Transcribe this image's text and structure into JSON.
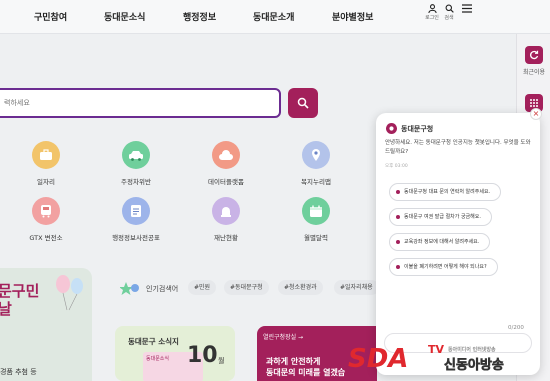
{
  "nav": {
    "items": [
      "구민참여",
      "동대문소식",
      "행정정보",
      "동대문소개",
      "분야별정보"
    ],
    "login_label": "로그인",
    "search_label": "검색"
  },
  "search": {
    "placeholder": "력하세요"
  },
  "right_rail": {
    "recent_label": "최근이용"
  },
  "quick_links": [
    {
      "label": "일자리",
      "color": "#f2c46a",
      "icon": "briefcase-icon"
    },
    {
      "label": "주정차위반",
      "color": "#6fcf9c",
      "icon": "car-icon"
    },
    {
      "label": "데이터플랫폼",
      "color": "#f29a86",
      "icon": "cloud-icon"
    },
    {
      "label": "복지누리맵",
      "color": "#b3c3ea",
      "icon": "map-icon"
    },
    {
      "label": "GTX 변전소",
      "color": "#f2a1a1",
      "icon": "bus-icon"
    },
    {
      "label": "행정정보사전공표",
      "color": "#9db4ea",
      "icon": "document-icon"
    },
    {
      "label": "재난현황",
      "color": "#c9b3e6",
      "icon": "siren-icon"
    },
    {
      "label": "월별달력",
      "color": "#6fcf9c",
      "icon": "calendar-icon"
    }
  ],
  "keywords": {
    "label": "인기검색어",
    "items": [
      "#민원",
      "#동대문구청",
      "#청소환경과",
      "#일자리채용"
    ]
  },
  "banners": {
    "left_big": "문구민\n날",
    "left_small": "경품 추첨 등",
    "news_title": "동대문구 소식지",
    "news_mini": "동대문소식",
    "news_num": "10",
    "news_month": "월",
    "open_title": "열린구청장실 →",
    "open_body": "과하게 안전하게\n동대문의 미래를 열겠습"
  },
  "chatbot": {
    "title": "동대문구청",
    "greeting": "안녕하세요. 저는 동대문구청 인공지능 챗봇입니다. 무엇을 도와드릴까요?",
    "time": "오후 03:00",
    "chips": [
      "동대문구청 대표 문의 연락처 알려주세요.",
      "동대문구 여권 발급 절차가 궁금해요.",
      "교육강좌 정보에 대해서 알려주세요.",
      "이불을 폐기하려면 어떻게 해야 되나요?"
    ],
    "counter": "0/200",
    "close": "×"
  },
  "watermark": {
    "sda": "SDA",
    "tv": "TV",
    "small": "동아미디어 인터넷방송",
    "big": "신동아방송"
  },
  "colors": {
    "accent": "#a3205b",
    "purple": "#6b2c91"
  }
}
